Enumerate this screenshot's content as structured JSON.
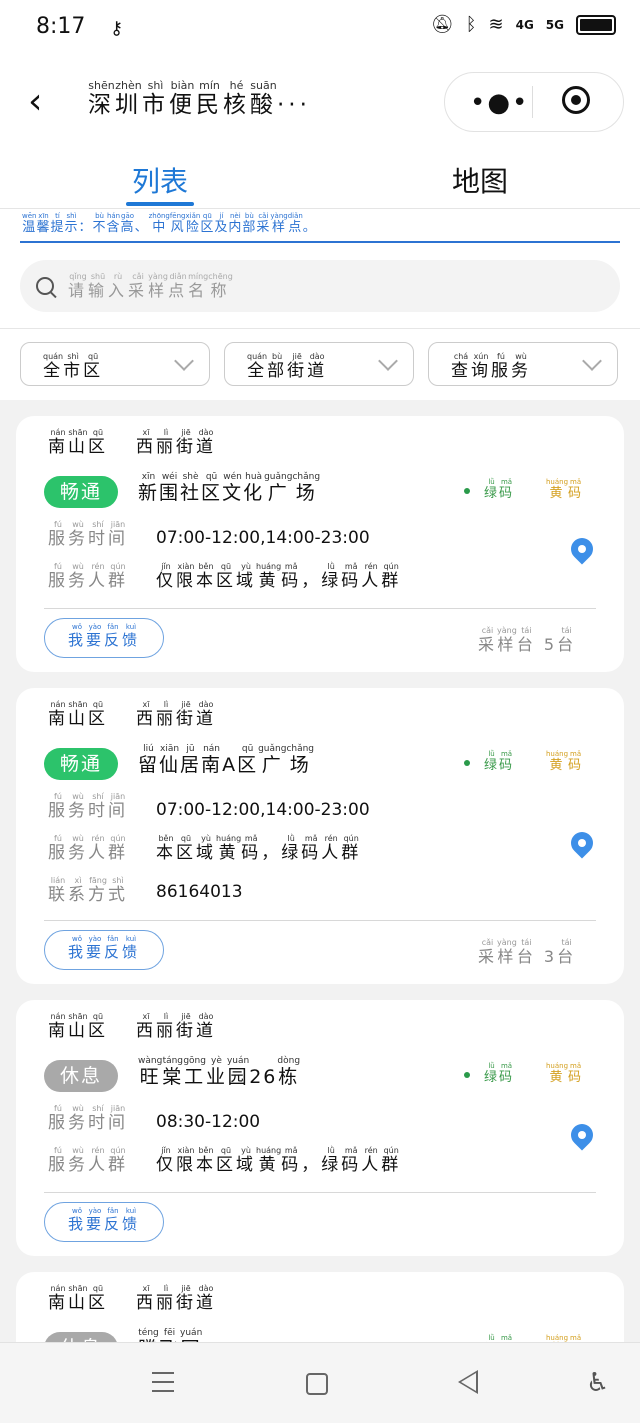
{
  "status_bar": {
    "time": "8:17",
    "network": "4G",
    "network2": "5G"
  },
  "header": {
    "title": [
      [
        "深",
        "shēn"
      ],
      [
        "圳",
        "zhèn"
      ],
      [
        "市",
        "shì"
      ],
      [
        "便",
        "biàn"
      ],
      [
        "民",
        "mín"
      ],
      [
        "核",
        "hé"
      ],
      [
        "酸",
        "suān"
      ]
    ],
    "ellipsis": "···"
  },
  "tabs": {
    "list": "列表",
    "map": "地图"
  },
  "notice": [
    [
      "温",
      "wēn"
    ],
    [
      "馨",
      "xīn"
    ],
    [
      "提",
      "tí"
    ],
    [
      "示",
      "shì"
    ],
    [
      "：",
      ""
    ],
    [
      "不",
      "bù"
    ],
    [
      "含",
      "hán"
    ],
    [
      "高",
      "gāo"
    ],
    [
      "、",
      ""
    ],
    [
      "中",
      "zhōng"
    ],
    [
      "风",
      "fēng"
    ],
    [
      "险",
      "xiǎn"
    ],
    [
      "区",
      "qū"
    ],
    [
      "及",
      "jí"
    ],
    [
      "内",
      "nèi"
    ],
    [
      "部",
      "bù"
    ],
    [
      "采",
      "cǎi"
    ],
    [
      "样",
      "yàng"
    ],
    [
      "点",
      "diǎn"
    ],
    [
      "。",
      ""
    ]
  ],
  "search": {
    "placeholder": [
      [
        "请",
        "qǐng"
      ],
      [
        "输",
        "shū"
      ],
      [
        "入",
        "rù"
      ],
      [
        "采",
        "cǎi"
      ],
      [
        "样",
        "yàng"
      ],
      [
        "点",
        "diǎn"
      ],
      [
        "名",
        "míng"
      ],
      [
        "称",
        "chēng"
      ]
    ]
  },
  "filters": [
    [
      [
        "全",
        "quán"
      ],
      [
        "市",
        "shì"
      ],
      [
        "区",
        "qū"
      ]
    ],
    [
      [
        "全",
        "quán"
      ],
      [
        "部",
        "bù"
      ],
      [
        "街",
        "jiē"
      ],
      [
        "道",
        "dào"
      ]
    ],
    [
      [
        "查",
        "chá"
      ],
      [
        "询",
        "xún"
      ],
      [
        "服",
        "fú"
      ],
      [
        "务",
        "wù"
      ]
    ]
  ],
  "labels": {
    "service_time": [
      [
        "服",
        "fú"
      ],
      [
        "务",
        "wù"
      ],
      [
        "时",
        "shí"
      ],
      [
        "间",
        "jiān"
      ]
    ],
    "service_group": [
      [
        "服",
        "fú"
      ],
      [
        "务",
        "wù"
      ],
      [
        "人",
        "rén"
      ],
      [
        "群",
        "qún"
      ]
    ],
    "contact": [
      [
        "联",
        "lián"
      ],
      [
        "系",
        "xì"
      ],
      [
        "方",
        "fāng"
      ],
      [
        "式",
        "shì"
      ]
    ],
    "green_code": [
      [
        "绿",
        "lǜ"
      ],
      [
        "码",
        "mǎ"
      ]
    ],
    "yellow_code": [
      [
        "黄",
        "huáng"
      ],
      [
        "码",
        "mǎ"
      ]
    ],
    "feedback": [
      [
        "我",
        "wǒ"
      ],
      [
        "要",
        "yào"
      ],
      [
        "反",
        "fǎn"
      ],
      [
        "馈",
        "kuì"
      ]
    ],
    "sampling": [
      [
        "采",
        "cǎi"
      ],
      [
        "样",
        "yàng"
      ],
      [
        "台",
        "tái"
      ]
    ],
    "unit_tai": [
      [
        "台",
        "tái"
      ]
    ]
  },
  "cards": [
    {
      "district": [
        [
          "南",
          "nán"
        ],
        [
          "山",
          "shān"
        ],
        [
          "区",
          "qū"
        ]
      ],
      "street": [
        [
          "西",
          "xī"
        ],
        [
          "丽",
          "lì"
        ],
        [
          "街",
          "jiē"
        ],
        [
          "道",
          "dào"
        ]
      ],
      "status": "畅通",
      "status_color": "#2cc36b",
      "name": [
        [
          "新",
          "xīn"
        ],
        [
          "围",
          "wéi"
        ],
        [
          "社",
          "shè"
        ],
        [
          "区",
          "qū"
        ],
        [
          "文",
          "wén"
        ],
        [
          "化",
          "huà"
        ],
        [
          "广",
          "guǎng"
        ],
        [
          "场",
          "chǎng"
        ]
      ],
      "hours": "07:00-12:00,14:00-23:00",
      "group": [
        [
          "仅",
          "jǐn"
        ],
        [
          "限",
          "xiàn"
        ],
        [
          "本",
          "běn"
        ],
        [
          "区",
          "qū"
        ],
        [
          "域",
          "yù"
        ],
        [
          "黄",
          "huáng"
        ],
        [
          "码",
          "mǎ"
        ],
        [
          "，",
          ""
        ],
        [
          "绿",
          "lǜ"
        ],
        [
          "码",
          "mǎ"
        ],
        [
          "人",
          "rén"
        ],
        [
          "群",
          "qún"
        ]
      ],
      "contact": "",
      "count": "5"
    },
    {
      "district": [
        [
          "南",
          "nán"
        ],
        [
          "山",
          "shān"
        ],
        [
          "区",
          "qū"
        ]
      ],
      "street": [
        [
          "西",
          "xī"
        ],
        [
          "丽",
          "lì"
        ],
        [
          "街",
          "jiē"
        ],
        [
          "道",
          "dào"
        ]
      ],
      "status": "畅通",
      "status_color": "#2cc36b",
      "name": [
        [
          "留",
          "liú"
        ],
        [
          "仙",
          "xiān"
        ],
        [
          "居",
          "jū"
        ],
        [
          "南",
          "nán"
        ],
        [
          "A",
          ""
        ],
        [
          "区",
          "qū"
        ],
        [
          "广",
          "guǎng"
        ],
        [
          "场",
          "chǎng"
        ]
      ],
      "hours": "07:00-12:00,14:00-23:00",
      "group": [
        [
          "本",
          "běn"
        ],
        [
          "区",
          "qū"
        ],
        [
          "域",
          "yù"
        ],
        [
          "黄",
          "huáng"
        ],
        [
          "码",
          "mǎ"
        ],
        [
          "，",
          ""
        ],
        [
          "绿",
          "lǜ"
        ],
        [
          "码",
          "mǎ"
        ],
        [
          "人",
          "rén"
        ],
        [
          "群",
          "qún"
        ]
      ],
      "contact": "86164013",
      "count": "3"
    },
    {
      "district": [
        [
          "南",
          "nán"
        ],
        [
          "山",
          "shān"
        ],
        [
          "区",
          "qū"
        ]
      ],
      "street": [
        [
          "西",
          "xī"
        ],
        [
          "丽",
          "lì"
        ],
        [
          "街",
          "jiē"
        ],
        [
          "道",
          "dào"
        ]
      ],
      "status": "休息",
      "status_color": "#a9a9a9",
      "name": [
        [
          "旺",
          "wàng"
        ],
        [
          "棠",
          "táng"
        ],
        [
          "工",
          "gōng"
        ],
        [
          "业",
          "yè"
        ],
        [
          "园",
          "yuán"
        ],
        [
          "26",
          ""
        ],
        [
          "栋",
          "dòng"
        ]
      ],
      "hours": "08:30-12:00",
      "group": [
        [
          "仅",
          "jǐn"
        ],
        [
          "限",
          "xiàn"
        ],
        [
          "本",
          "běn"
        ],
        [
          "区",
          "qū"
        ],
        [
          "域",
          "yù"
        ],
        [
          "黄",
          "huáng"
        ],
        [
          "码",
          "mǎ"
        ],
        [
          "，",
          ""
        ],
        [
          "绿",
          "lǜ"
        ],
        [
          "码",
          "mǎ"
        ],
        [
          "人",
          "rén"
        ],
        [
          "群",
          "qún"
        ]
      ],
      "contact": "",
      "count": ""
    },
    {
      "district": [
        [
          "南",
          "nán"
        ],
        [
          "山",
          "shān"
        ],
        [
          "区",
          "qū"
        ]
      ],
      "street": [
        [
          "西",
          "xī"
        ],
        [
          "丽",
          "lì"
        ],
        [
          "街",
          "jiē"
        ],
        [
          "道",
          "dào"
        ]
      ],
      "status": "休息",
      "status_color": "#a9a9a9",
      "name": [
        [
          "腾",
          "téng"
        ],
        [
          "飞",
          "fēi"
        ],
        [
          "园",
          "yuán"
        ]
      ],
      "hours": "",
      "group": [],
      "contact": "",
      "count": ""
    }
  ]
}
